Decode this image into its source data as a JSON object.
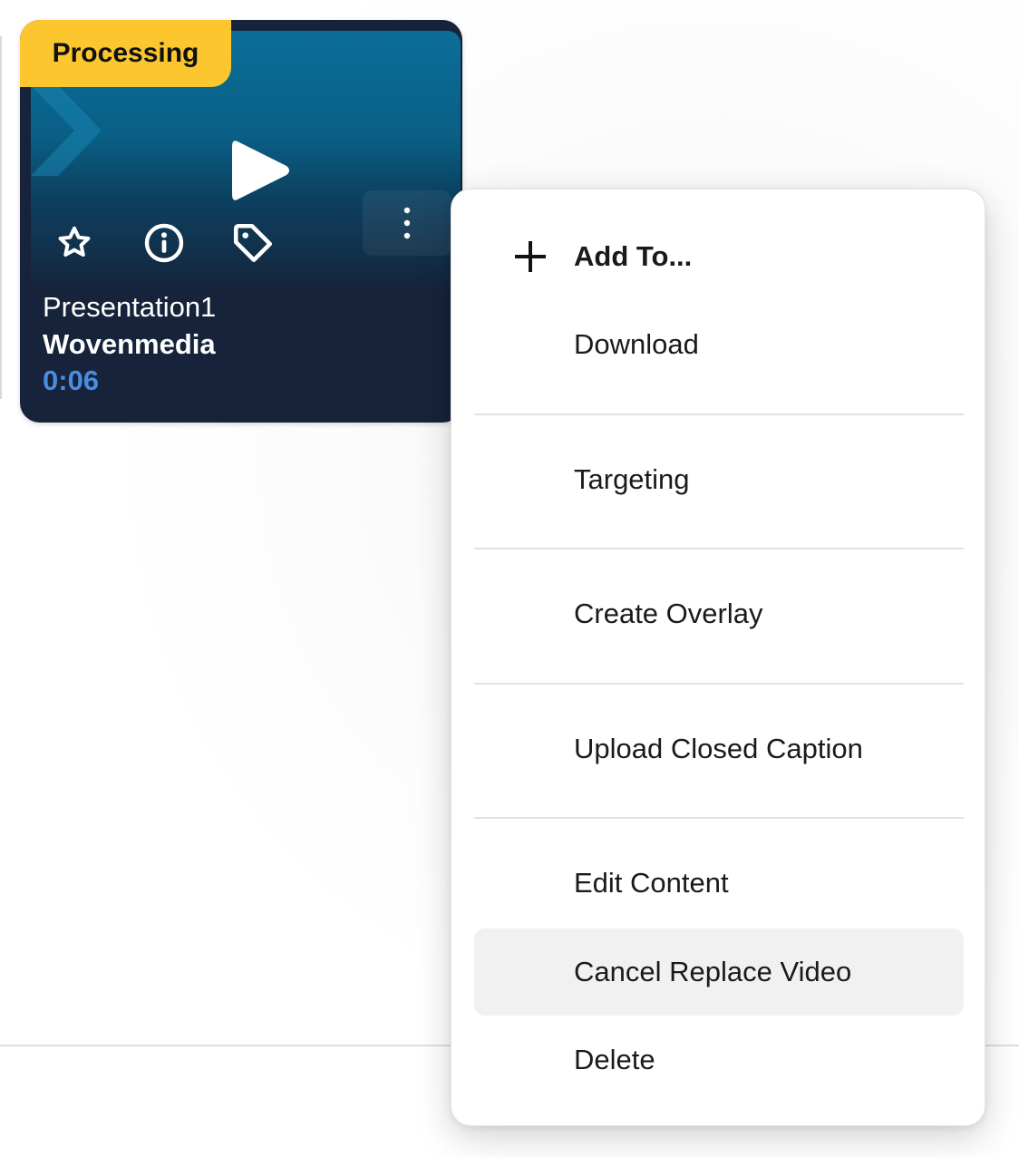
{
  "card": {
    "status_badge": "Processing",
    "title": "Presentation1",
    "owner": "Wovenmedia",
    "duration": "0:06",
    "actions": {
      "favorite_icon": "star-icon",
      "info_icon": "info-icon",
      "tag_icon": "tag-icon",
      "more_icon": "more-vertical-icon",
      "play_icon": "play-icon"
    }
  },
  "menu": {
    "items": [
      {
        "label": "Add To...",
        "icon": "plus-icon",
        "bold": true
      },
      {
        "label": "Download"
      },
      {
        "label": "Targeting"
      },
      {
        "label": "Create Overlay"
      },
      {
        "label": "Upload Closed Caption"
      },
      {
        "label": "Edit Content"
      },
      {
        "label": "Cancel Replace Video",
        "highlighted": true
      },
      {
        "label": "Delete"
      }
    ]
  },
  "colors": {
    "badge": "#fcc62f",
    "card_bg": "#16233a",
    "thumb_blue": "#0c6e98",
    "duration_blue": "#4a8de0",
    "highlight": "#f1f1f1"
  }
}
